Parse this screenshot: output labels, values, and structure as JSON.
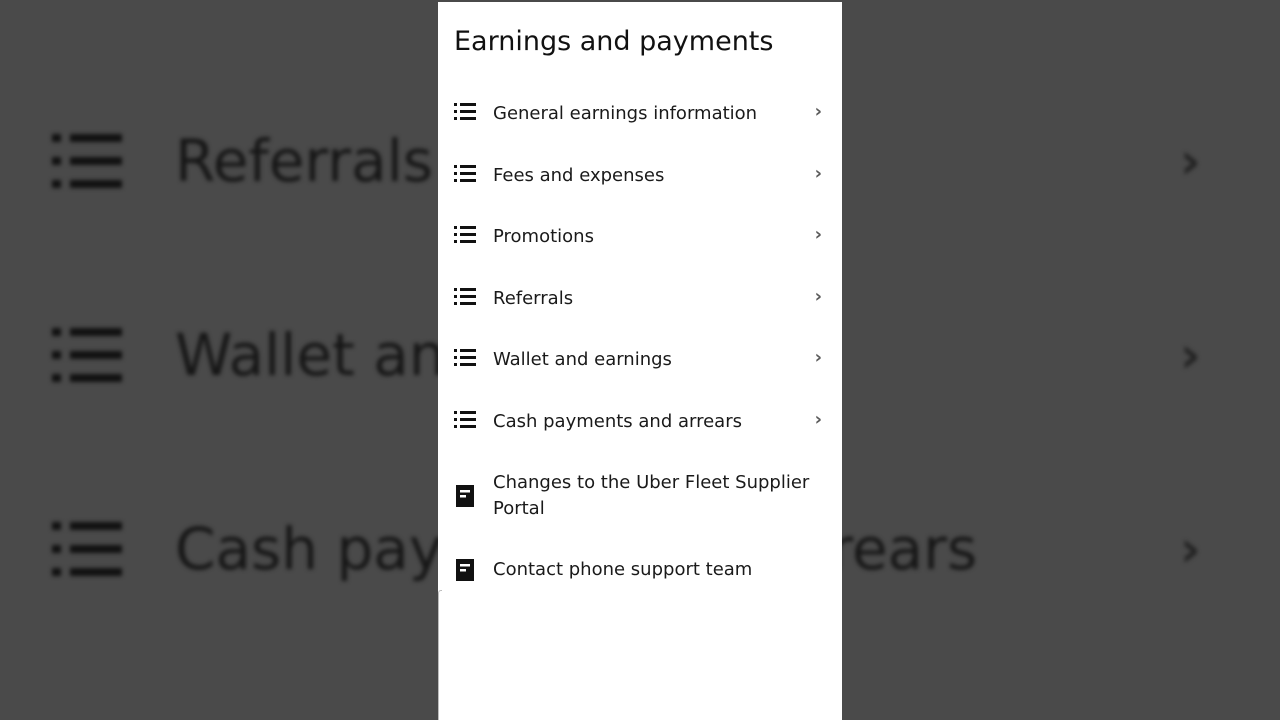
{
  "background": {
    "rows": [
      {
        "label": "Referrals",
        "chevron": "›"
      },
      {
        "label": "Wallet and earnings",
        "chevron": "›"
      },
      {
        "label": "Cash payments and arrears",
        "chevron": "›"
      }
    ]
  },
  "panel": {
    "title": "Earnings and payments",
    "items": [
      {
        "label": "General earnings information",
        "icon": "list-icon",
        "chevron": "›"
      },
      {
        "label": "Fees and expenses",
        "icon": "list-icon",
        "chevron": "›"
      },
      {
        "label": "Promotions",
        "icon": "list-icon",
        "chevron": "›"
      },
      {
        "label": "Referrals",
        "icon": "list-icon",
        "chevron": "›"
      },
      {
        "label": "Wallet and earnings",
        "icon": "list-icon",
        "chevron": "›"
      },
      {
        "label": "Cash payments and arrears",
        "icon": "list-icon",
        "chevron": "›"
      },
      {
        "label": "Changes to the Uber Fleet Supplier Portal",
        "icon": "document-icon"
      },
      {
        "label": "Contact phone support team",
        "icon": "document-icon"
      }
    ]
  },
  "colors": {
    "backdrop": "#4a4a4a",
    "panel": "#ffffff",
    "text": "#1a1a1a",
    "chevron": "#5a5a5a"
  }
}
